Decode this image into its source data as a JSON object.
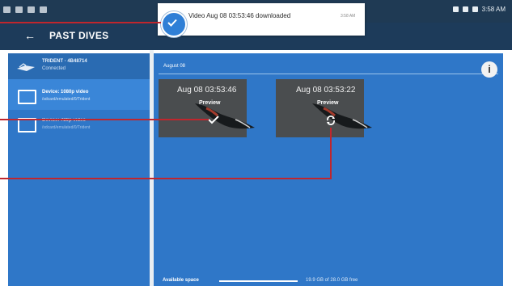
{
  "status_bar": {
    "time": "3:58 AM"
  },
  "app_bar": {
    "back_glyph": "←",
    "title": "PAST DIVES"
  },
  "notification": {
    "text": "Video Aug 08 03:53:46 downloaded",
    "time": "3:58 AM"
  },
  "sidebar": {
    "trident": {
      "title": "TRIDENT · 4B48714",
      "subtitle": "Connected"
    },
    "devices": [
      {
        "title": "Device: 1080p video",
        "subtitle": "/sdcard/emulated/0/Trident"
      },
      {
        "title": "Device: 720p video",
        "subtitle": "/sdcard/emulated/0/Trident"
      }
    ]
  },
  "main": {
    "date_header": "August 08",
    "info_glyph": "i",
    "videos": [
      {
        "title": "Aug 08 03:53:46",
        "action": "Preview",
        "state_icon": "check-icon"
      },
      {
        "title": "Aug 08 03:53:22",
        "action": "Preview",
        "state_icon": "sync-icon"
      }
    ],
    "storage": {
      "label": "Available space",
      "free_text": "19.9 GB of 28.0 GB free",
      "used_fraction": 0.29
    }
  },
  "colors": {
    "panel": "#2f77c8",
    "app_bar": "#1d3b5a",
    "callout": "#c0262d"
  }
}
